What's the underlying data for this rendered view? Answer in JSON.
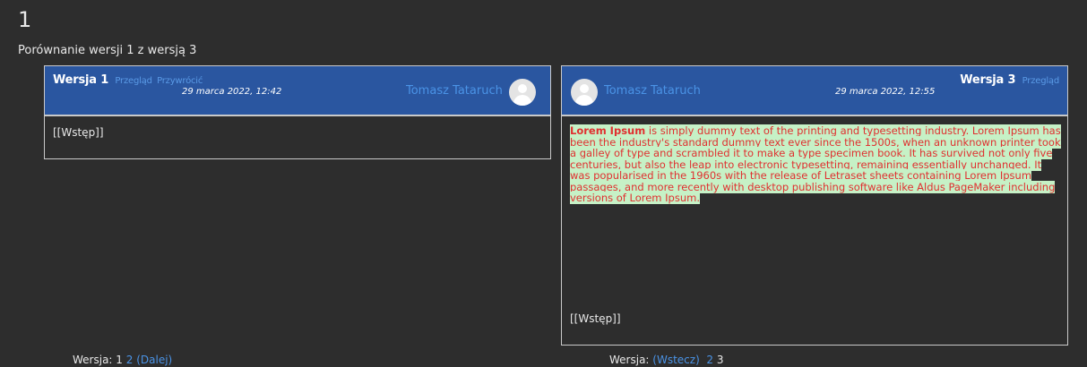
{
  "page": {
    "heading": "1",
    "compare_title": "Porównanie wersji 1 z wersją 3"
  },
  "left_panel": {
    "version_label": "Wersja 1",
    "review_link": "Przegląd",
    "restore_link": "Przywrócić",
    "date": "29 marca 2022, 12:42",
    "author": "Tomasz Tataruch",
    "content": "[[Wstęp]]"
  },
  "right_panel": {
    "version_label": "Wersja 3",
    "review_link": "Przegląd",
    "date": "29 marca 2022, 12:55",
    "author": "Tomasz Tataruch",
    "diff_bold": "Lorem Ipsum",
    "diff_text": " is simply dummy text of the printing and typesetting industry. Lorem Ipsum has been the industry's standard dummy text ever since the 1500s, when an unknown printer took a galley of type and scrambled it to make a type specimen book. It has survived not only five centuries, but also the leap into electronic typesetting, remaining essentially unchanged. It was popularised in the 1960s with the release of Letraset sheets containing Lorem Ipsum passages, and more recently with desktop publishing software like Aldus PageMaker including versions of Lorem Ipsum.",
    "content": "[[Wstęp]]"
  },
  "left_pager": {
    "label": "Wersja:",
    "current": "1",
    "page_2": "2",
    "next": "(Dalej)"
  },
  "right_pager": {
    "label": "Wersja:",
    "prev": "(Wstecz)",
    "page_2": "2",
    "current": "3"
  },
  "colors": {
    "background": "#2d2d2d",
    "header": "#2a56a0",
    "link": "#4a93e6",
    "diff_added_bg": "#c6f1c6",
    "diff_text": "#e03030"
  }
}
